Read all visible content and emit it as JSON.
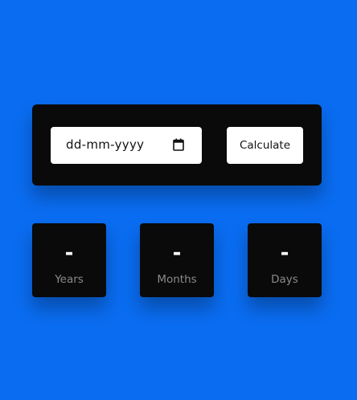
{
  "form": {
    "date_placeholder": "dd-mm-yyyy",
    "calendar_icon": "calendar-icon",
    "calculate_label": "Calculate"
  },
  "results": {
    "years": {
      "value": "-",
      "label": "Years"
    },
    "months": {
      "value": "-",
      "label": "Months"
    },
    "days": {
      "value": "-",
      "label": "Days"
    }
  },
  "colors": {
    "background": "#0a6cf0",
    "panel": "#0a0a0a",
    "label": "#8a8a8a"
  }
}
